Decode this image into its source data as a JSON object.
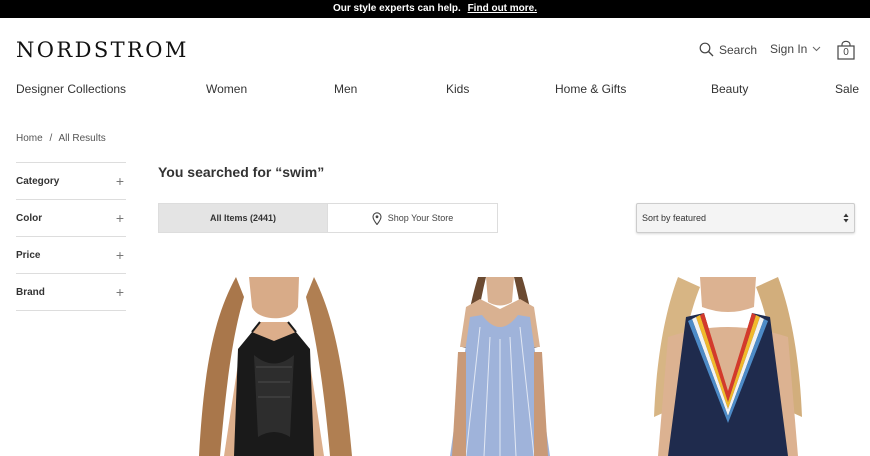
{
  "promo": {
    "text": "Our style experts can help.",
    "link": "Find out more."
  },
  "header": {
    "logo": "NORDSTROM",
    "search_label": "Search",
    "signin_label": "Sign In",
    "bag_count": "0"
  },
  "nav": [
    "Designer Collections",
    "Women",
    "Men",
    "Kids",
    "Home & Gifts",
    "Beauty",
    "Sale"
  ],
  "breadcrumb": {
    "home": "Home",
    "separator": "/",
    "current": "All Results"
  },
  "filters": [
    "Category",
    "Color",
    "Price",
    "Brand"
  ],
  "search": {
    "heading": "You searched for “swim”",
    "tab_all": "All Items (2441)",
    "tab_store": "Shop Your Store"
  },
  "sort": {
    "selected": "Sort by featured"
  },
  "products": [
    {
      "icon": "black-lace-one-piece-swimsuit"
    },
    {
      "icon": "blue-striped-swim-cover-up-dress"
    },
    {
      "icon": "navy-v-neck-striped-trim-swimsuit"
    }
  ]
}
